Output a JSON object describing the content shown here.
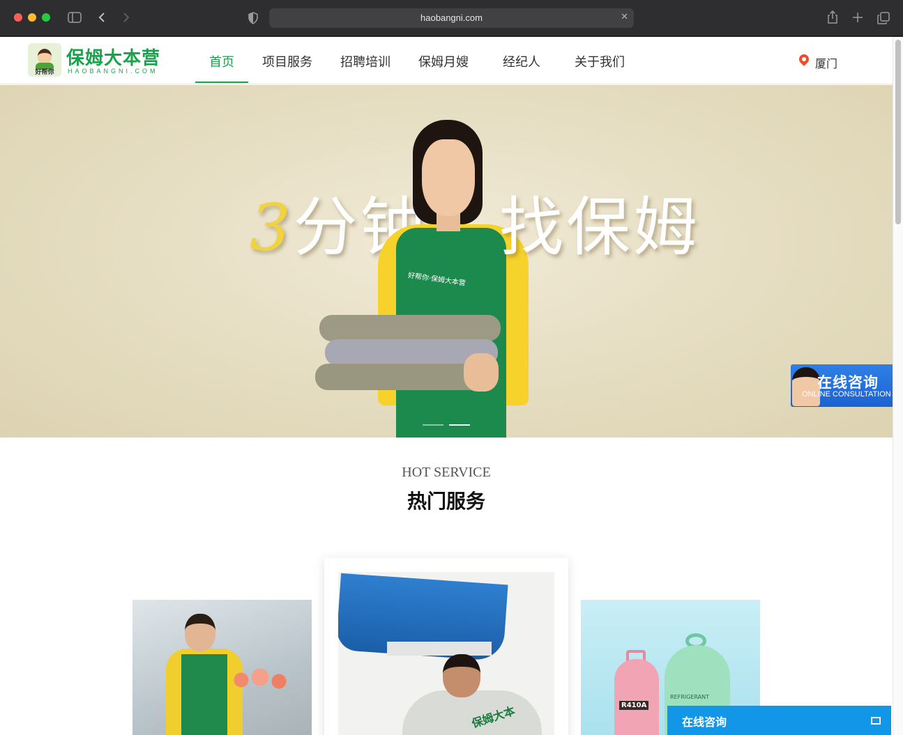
{
  "browser": {
    "url": "haobangni.com"
  },
  "header": {
    "logo": {
      "title": "保姆大本营",
      "domain": "HAOBANGNI.COM",
      "badge_text": "好帮你"
    },
    "nav": [
      {
        "label": "首页",
        "active": true
      },
      {
        "label": "项目服务",
        "active": false
      },
      {
        "label": "招聘培训",
        "active": false
      },
      {
        "label": "保姆月嫂",
        "active": false
      },
      {
        "label": "经纪人",
        "active": false
      },
      {
        "label": "关于我们",
        "active": false
      }
    ],
    "location": "厦门"
  },
  "banner": {
    "text_left_digit": "3",
    "text_left": "分钟",
    "text_right": "找保姆",
    "apron_text": "好帮你·保姆大本营",
    "slide_count": 2,
    "active_slide": 2
  },
  "consult_widget": {
    "title": "在线咨询",
    "subtitle": "ONLINE CONSULTATION"
  },
  "hot_service": {
    "title_en": "HOT SERVICE",
    "title_cn": "热门服务",
    "cards": [
      {
        "image": "housekeeper-photo"
      },
      {
        "image": "aircon-cleaning-photo",
        "overlay_text": "保姆大本"
      },
      {
        "image": "refrigerant-tanks-photo",
        "tank_labels": [
          "R410A",
          "REFRIGERANT"
        ]
      }
    ]
  },
  "chat_bar": {
    "label": "在线咨询"
  },
  "colors": {
    "brand_green": "#18a34b",
    "consult_blue": "#1b63d3",
    "chatbar_blue": "#1196e8",
    "location_red": "#f24b2a"
  }
}
